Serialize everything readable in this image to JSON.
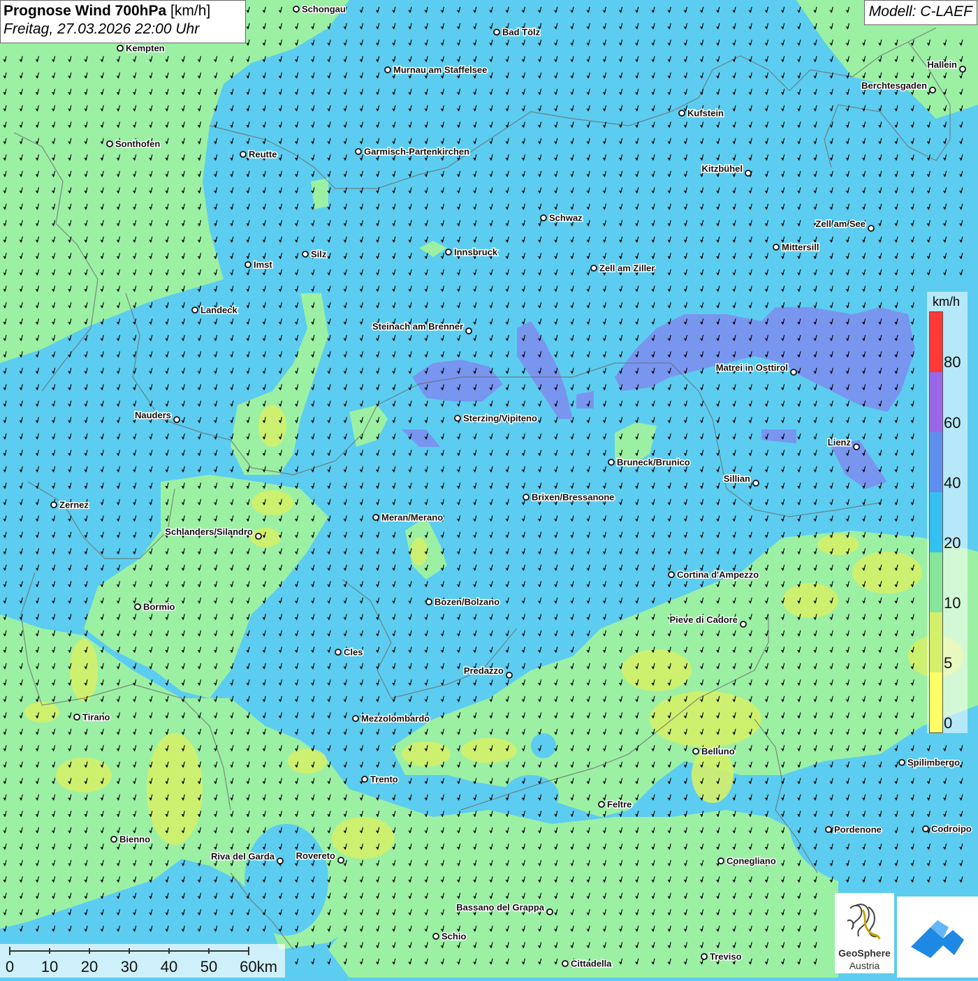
{
  "header": {
    "title_bold": "Prognose Wind 700hPa",
    "title_unit": "[km/h]",
    "datetime": "Freitag, 27.03.2026 22:00 Uhr"
  },
  "model": "Modell: C-LAEF",
  "legend": {
    "unit": "km/h",
    "ticks": [
      "80",
      "60",
      "40",
      "20",
      "10",
      "5",
      "0"
    ],
    "colors": [
      "#ff3838",
      "#9a67e8",
      "#5e8ff0",
      "#36c0f0",
      "#86e69a",
      "#d4f06a",
      "#ffff66"
    ]
  },
  "scalebar": {
    "labels": [
      "0",
      "10",
      "20",
      "30",
      "40",
      "50",
      "60km"
    ]
  },
  "logos": {
    "geosphere_line1": "GeoSphere",
    "geosphere_line2": "Austria"
  },
  "cities": [
    {
      "name": "Schongau"
    },
    {
      "name": "Bad Tölz"
    },
    {
      "name": "Kempten"
    },
    {
      "name": "Murnau am Staffelsee"
    },
    {
      "name": "Hallein"
    },
    {
      "name": "Berchtesgaden"
    },
    {
      "name": "Kufstein"
    },
    {
      "name": "Sonthofen"
    },
    {
      "name": "Reutte"
    },
    {
      "name": "Garmisch-Partenkirchen"
    },
    {
      "name": "Kitzbühel"
    },
    {
      "name": "Schwaz"
    },
    {
      "name": "Zell am See"
    },
    {
      "name": "Silz"
    },
    {
      "name": "Innsbruck"
    },
    {
      "name": "Mittersill"
    },
    {
      "name": "Imst"
    },
    {
      "name": "Zell am Ziller"
    },
    {
      "name": "Landeck"
    },
    {
      "name": "Steinach am Brenner"
    },
    {
      "name": "Matrei in Osttirol"
    },
    {
      "name": "Nauders"
    },
    {
      "name": "Sterzing/Vipiteno"
    },
    {
      "name": "Lienz"
    },
    {
      "name": "Bruneck/Brunico"
    },
    {
      "name": "Sillian"
    },
    {
      "name": "Zernez"
    },
    {
      "name": "Brixen/Bressanone"
    },
    {
      "name": "Meran/Merano"
    },
    {
      "name": "Schlanders/Silandro"
    },
    {
      "name": "Cortina d'Ampezzo"
    },
    {
      "name": "Bozen/Bolzano"
    },
    {
      "name": "Bormio"
    },
    {
      "name": "Pieve di Cadore"
    },
    {
      "name": "Cles"
    },
    {
      "name": "Predazzo"
    },
    {
      "name": "Tirano"
    },
    {
      "name": "Mezzolombardo"
    },
    {
      "name": "Belluno"
    },
    {
      "name": "Spilimbergo"
    },
    {
      "name": "Trento"
    },
    {
      "name": "Feltre"
    },
    {
      "name": "Pordenone"
    },
    {
      "name": "Codroipo"
    },
    {
      "name": "Bienno"
    },
    {
      "name": "Riva del Garda"
    },
    {
      "name": "Rovereto"
    },
    {
      "name": "Conegliano"
    },
    {
      "name": "Bassano del Grappa"
    },
    {
      "name": "Schio"
    },
    {
      "name": "Treviso"
    },
    {
      "name": "Cittadella"
    }
  ]
}
